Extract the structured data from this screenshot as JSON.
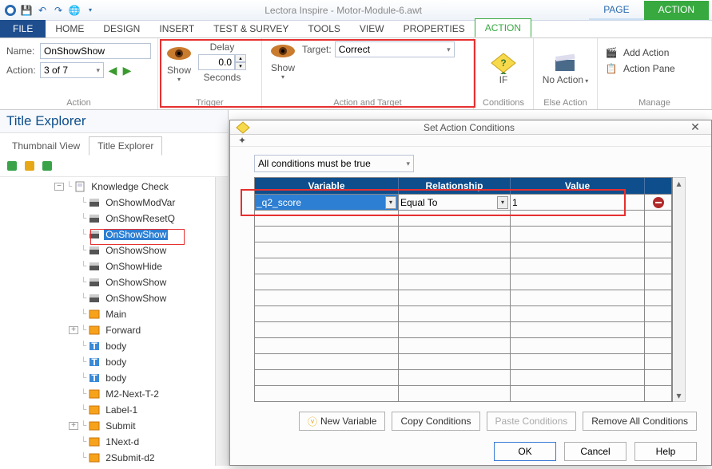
{
  "app": {
    "title": "Lectora Inspire - Motor-Module-6.awt"
  },
  "context_tabs": {
    "page": "PAGE",
    "action": "ACTION"
  },
  "menu": {
    "file": "FILE",
    "home": "HOME",
    "design": "DESIGN",
    "insert": "INSERT",
    "test": "TEST & SURVEY",
    "tools": "TOOLS",
    "view": "VIEW",
    "properties": "PROPERTIES",
    "action": "ACTION"
  },
  "ribbon": {
    "action": {
      "title": "Action",
      "name_label": "Name:",
      "name_value": "OnShowShow",
      "action_label": "Action:",
      "action_value": "3 of 7"
    },
    "trigger": {
      "title": "Trigger",
      "show": "Show",
      "delay_label": "Delay",
      "delay_value": "0.0",
      "seconds": "Seconds"
    },
    "target": {
      "title": "Action and Target",
      "show": "Show",
      "target_label": "Target:",
      "target_value": "Correct"
    },
    "conditions": {
      "title": "Conditions",
      "if": "IF"
    },
    "else": {
      "title": "Else Action",
      "no_action": "No Action"
    },
    "manage": {
      "title": "Manage",
      "add": "Add Action",
      "pane": "Action Pane"
    }
  },
  "explorer": {
    "title": "Title Explorer",
    "tabs": {
      "thumb": "Thumbnail View",
      "tree": "Title Explorer"
    },
    "items": [
      {
        "indent": 1,
        "exp": "-",
        "icon": "page",
        "text": "Knowledge Check"
      },
      {
        "indent": 2,
        "icon": "action",
        "text": "OnShowModVar"
      },
      {
        "indent": 2,
        "icon": "action",
        "text": "OnShowResetQ"
      },
      {
        "indent": 2,
        "icon": "action",
        "text": "OnShowShow",
        "selected": true
      },
      {
        "indent": 2,
        "icon": "action",
        "text": "OnShowShow"
      },
      {
        "indent": 2,
        "icon": "action",
        "text": "OnShowHide"
      },
      {
        "indent": 2,
        "icon": "action",
        "text": "OnShowShow"
      },
      {
        "indent": 2,
        "icon": "action",
        "text": "OnShowShow"
      },
      {
        "indent": 2,
        "icon": "img",
        "text": "Main"
      },
      {
        "indent": 2,
        "exp": "+",
        "icon": "img",
        "text": "Forward"
      },
      {
        "indent": 2,
        "icon": "text",
        "text": "body"
      },
      {
        "indent": 2,
        "icon": "text",
        "text": "body"
      },
      {
        "indent": 2,
        "icon": "text",
        "text": "body"
      },
      {
        "indent": 2,
        "icon": "img",
        "text": "M2-Next-T-2"
      },
      {
        "indent": 2,
        "icon": "img",
        "text": "Label-1"
      },
      {
        "indent": 2,
        "exp": "+",
        "icon": "img",
        "text": "Submit"
      },
      {
        "indent": 2,
        "icon": "img",
        "text": "1Next-d"
      },
      {
        "indent": 2,
        "icon": "img",
        "text": "2Submit-d2"
      }
    ]
  },
  "dialog": {
    "title": "Set Action Conditions",
    "all_cond": "All conditions must be true",
    "headers": {
      "var": "Variable",
      "rel": "Relationship",
      "val": "Value"
    },
    "row": {
      "var": "_q2_score",
      "rel": "Equal To",
      "val": "1"
    },
    "buttons": {
      "newvar": "New Variable",
      "copy": "Copy Conditions",
      "paste": "Paste Conditions",
      "removeall": "Remove All Conditions",
      "ok": "OK",
      "cancel": "Cancel",
      "help": "Help"
    }
  }
}
